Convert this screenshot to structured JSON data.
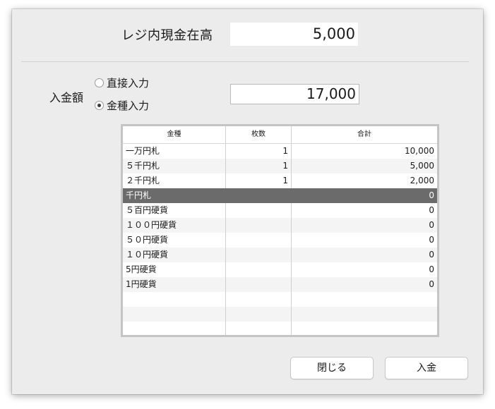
{
  "register_cash": {
    "label": "レジ内現金在高",
    "value": "5,000"
  },
  "deposit": {
    "label": "入金額",
    "radio_direct": "直接入力",
    "radio_denomination": "金種入力",
    "amount": "17,000"
  },
  "table": {
    "headers": [
      "金種",
      "枚数",
      "合計"
    ],
    "rows": [
      {
        "kind": "一万円札",
        "count": "1",
        "total": "10,000"
      },
      {
        "kind": "５千円札",
        "count": "1",
        "total": "5,000"
      },
      {
        "kind": "２千円札",
        "count": "1",
        "total": "2,000"
      },
      {
        "kind": "千円札",
        "count": "",
        "total": "0"
      },
      {
        "kind": "５百円硬貨",
        "count": "",
        "total": "0"
      },
      {
        "kind": "１００円硬貨",
        "count": "",
        "total": "0"
      },
      {
        "kind": "５０円硬貨",
        "count": "",
        "total": "0"
      },
      {
        "kind": "１０円硬貨",
        "count": "",
        "total": "0"
      },
      {
        "kind": "5円硬貨",
        "count": "",
        "total": "0"
      },
      {
        "kind": "1円硬貨",
        "count": "",
        "total": "0"
      },
      {
        "kind": "",
        "count": "",
        "total": ""
      },
      {
        "kind": "",
        "count": "",
        "total": ""
      },
      {
        "kind": "",
        "count": "",
        "total": ""
      }
    ],
    "selected_row": 3
  },
  "buttons": {
    "close": "閉じる",
    "deposit": "入金"
  }
}
